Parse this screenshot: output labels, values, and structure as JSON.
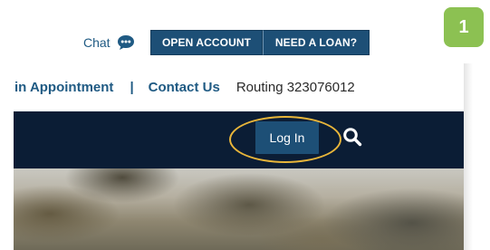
{
  "utility": {
    "chat_label": "Chat",
    "open_account_label": "OPEN ACCOUNT",
    "need_loan_label": "NEED A LOAN?"
  },
  "links": {
    "appointment_label": "in Appointment",
    "separator": "|",
    "contact_label": "Contact Us",
    "routing_text": "Routing 323076012"
  },
  "nav": {
    "login_label": "Log In"
  },
  "step": {
    "number": "1"
  },
  "colors": {
    "brand_navy": "#0b1d35",
    "brand_blue": "#1d4f76",
    "link_blue": "#1f5a83",
    "highlight": "#e8b53a",
    "step_green": "#8cc152"
  },
  "icons": {
    "chat": "chat-bubble-icon",
    "search": "search-icon"
  }
}
